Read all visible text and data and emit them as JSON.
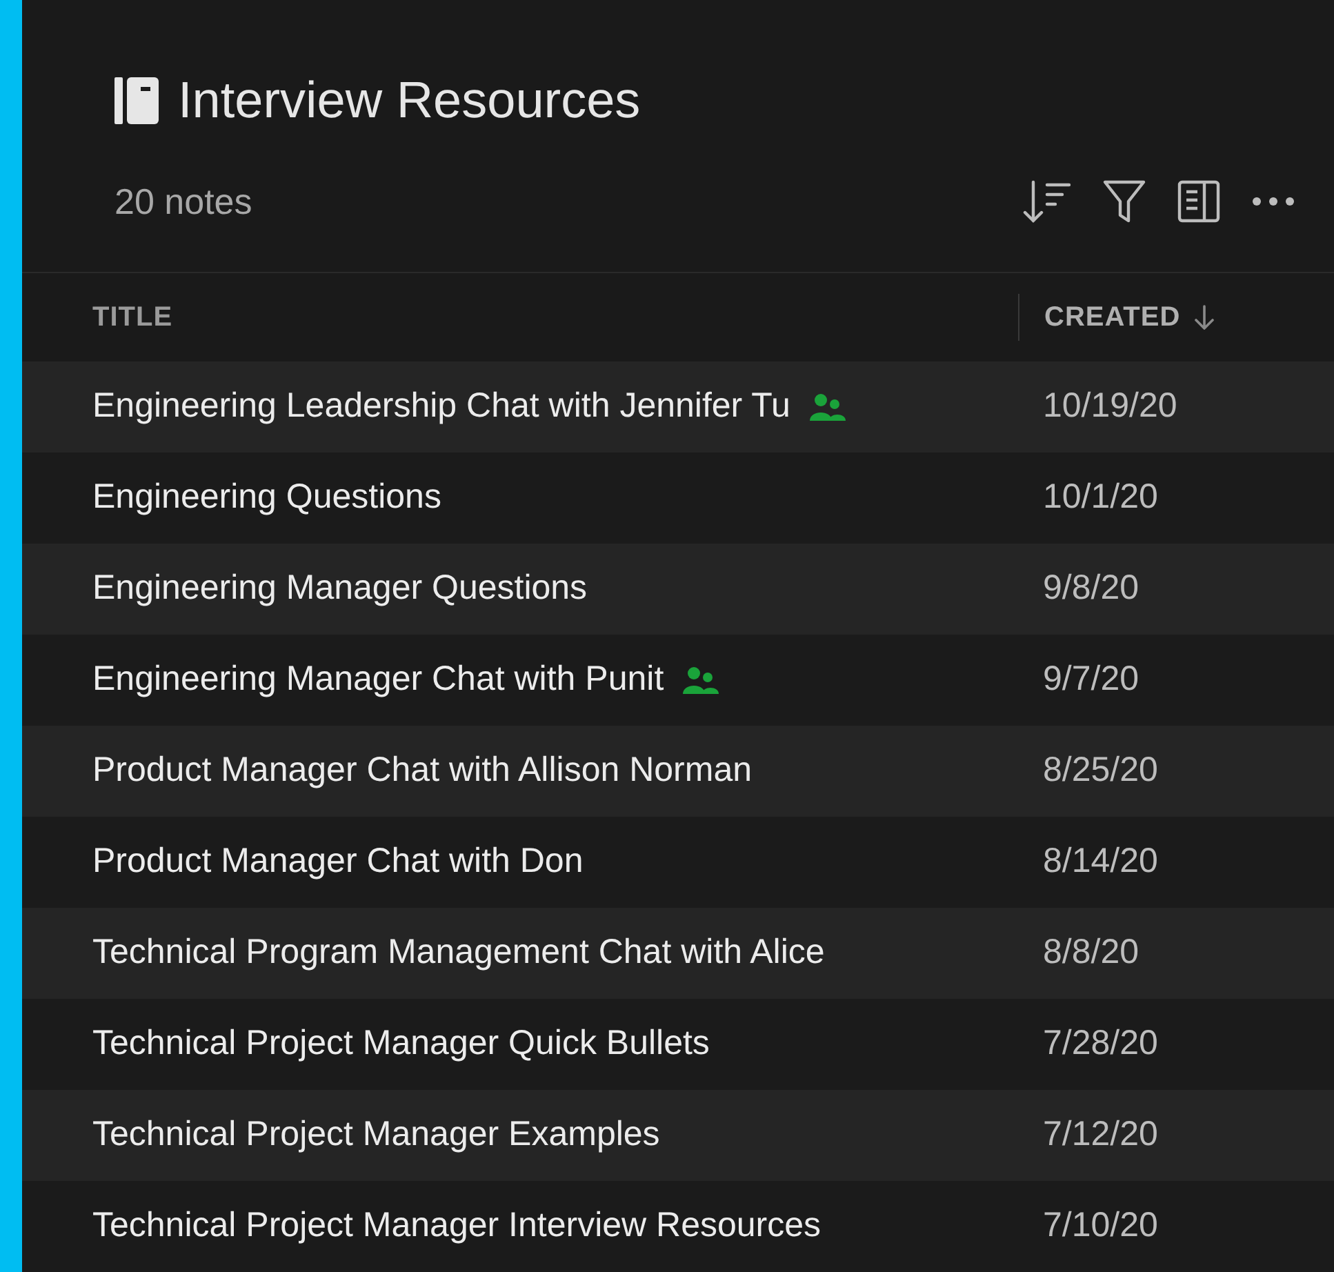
{
  "notebook": {
    "title": "Interview Resources",
    "count": "20 notes"
  },
  "table": {
    "columns": [
      {
        "label": "TITLE",
        "sorted": false
      },
      {
        "label": "CREATED",
        "sorted": true
      }
    ],
    "rows": [
      {
        "title": "Engineering Leadership Chat with Jennifer Tu",
        "created": "10/19/20",
        "shared": true
      },
      {
        "title": "Engineering Questions",
        "created": "10/1/20",
        "shared": false
      },
      {
        "title": "Engineering Manager Questions",
        "created": "9/8/20",
        "shared": false
      },
      {
        "title": "Engineering Manager Chat with Punit",
        "created": "9/7/20",
        "shared": true
      },
      {
        "title": "Product Manager Chat with Allison Norman",
        "created": "8/25/20",
        "shared": false
      },
      {
        "title": "Product Manager Chat with Don",
        "created": "8/14/20",
        "shared": false
      },
      {
        "title": "Technical Program Management Chat with Alice",
        "created": "8/8/20",
        "shared": false
      },
      {
        "title": "Technical Project Manager Quick Bullets",
        "created": "7/28/20",
        "shared": false
      },
      {
        "title": "Technical Project Manager Examples",
        "created": "7/12/20",
        "shared": false
      },
      {
        "title": "Technical Project Manager Interview Resources",
        "created": "7/10/20",
        "shared": false
      }
    ]
  }
}
